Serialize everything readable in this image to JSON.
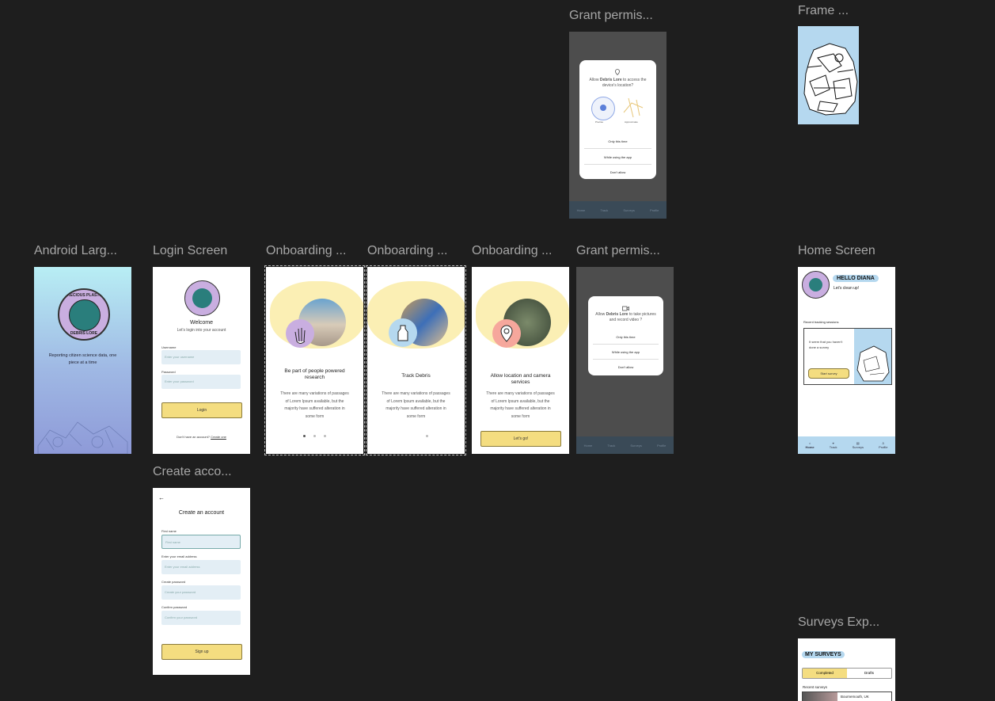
{
  "labels": {
    "grant_top": "Grant permis...",
    "frame_top": "Frame ...",
    "android": "Android Larg...",
    "login": "Login Screen",
    "onb1": "Onboarding ...",
    "onb2": "Onboarding ...",
    "onb3": "Onboarding ...",
    "grant_mid": "Grant permis...",
    "home": "Home Screen",
    "create": "Create acco...",
    "surveys": "Surveys Exp..."
  },
  "location_dialog": {
    "line1": "Allow",
    "app": "Debris Lore",
    "line2": "to access the device's location?",
    "precise": "Precise",
    "approx": "Approximate",
    "opt1": "Only this time",
    "opt2": "While using the app",
    "opt3": "Don't allow"
  },
  "camera_dialog": {
    "line1": "Allow",
    "app": "Debris Lore",
    "line2": "to take pictures and record video ?",
    "opt1": "Only this time",
    "opt2": "While using the app",
    "opt3": "Don't allow"
  },
  "android": {
    "badge_top": "PRECIOUS PLASTIC",
    "badge_bottom": "DEBRIS LORE",
    "tagline": "Reporting citizen science data, one piece at a time"
  },
  "login": {
    "title": "Welcome",
    "subtitle": "Let's login into your account",
    "username_label": "Username",
    "username_placeholder": "Enter your username",
    "password_label": "Password",
    "password_placeholder": "Enter your password",
    "button": "Login",
    "footer_text": "Don't have an account?",
    "footer_link": "Create one"
  },
  "onb1": {
    "title": "Be part of people powered research",
    "body": "There are many variations of passages of Lorem Ipsum available, but the majority have suffered alteration in some form"
  },
  "onb2": {
    "title": "Track Debris",
    "body": "There are many variations of passages of Lorem Ipsum available, but the majority have suffered alteration in some form"
  },
  "onb3": {
    "title": "Allow location and camera services",
    "body": "There are many variations of passages of Lorem Ipsum available, but the majority have suffered alteration in some form",
    "button": "Let's go!"
  },
  "nav": {
    "home": "Home",
    "track": "Track",
    "surveys": "Surveys",
    "profile": "Profile"
  },
  "home": {
    "hello": "HELLO DIANA",
    "sub": "Let's clean up!",
    "section": "Recent tracking sessions",
    "card_text": "It seem that you haven't done a survey",
    "card_button": "Start survey"
  },
  "create": {
    "title": "Create an account",
    "first_label": "First name",
    "first_ph": "First name",
    "email_label": "Enter your email address",
    "email_ph": "Enter your email address",
    "pass_label": "Create password",
    "pass_ph": "Create your password",
    "confirm_label": "Confirm password",
    "confirm_ph": "Confirm your password",
    "button": "Sign up"
  },
  "surveys": {
    "title": "MY SURVEYS",
    "tab_completed": "Completed",
    "tab_drafts": "Drafts",
    "recent": "Recent surveys",
    "item_location": "Bournemouth, UK"
  },
  "colors": {
    "canvas": "#1e1e1e",
    "accent_yellow": "#f4dd80",
    "sky": "#b5d8ef",
    "badge_purple": "#c9aee0"
  }
}
